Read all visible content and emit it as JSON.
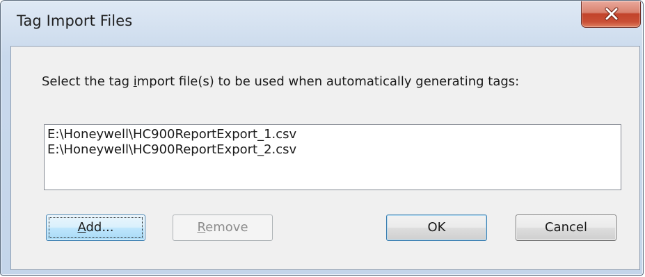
{
  "window": {
    "title": "Tag Import Files"
  },
  "dialog": {
    "prompt_parts": [
      "Select the tag ",
      "i",
      "mport file(s) to be used when automatically generating tags:"
    ],
    "files": [
      "E:\\Honeywell\\HC900ReportExport_1.csv",
      "E:\\Honeywell\\HC900ReportExport_2.csv"
    ]
  },
  "buttons": {
    "add": {
      "mnemonic": "A",
      "rest": "dd..."
    },
    "remove": {
      "mnemonic": "R",
      "rest": "emove"
    },
    "ok": "OK",
    "cancel": "Cancel"
  },
  "icons": {
    "close": "close-icon"
  },
  "colors": {
    "close_button": "#c94f35",
    "focus_border": "#3c7fb1",
    "client_bg": "#f0f0f0"
  }
}
